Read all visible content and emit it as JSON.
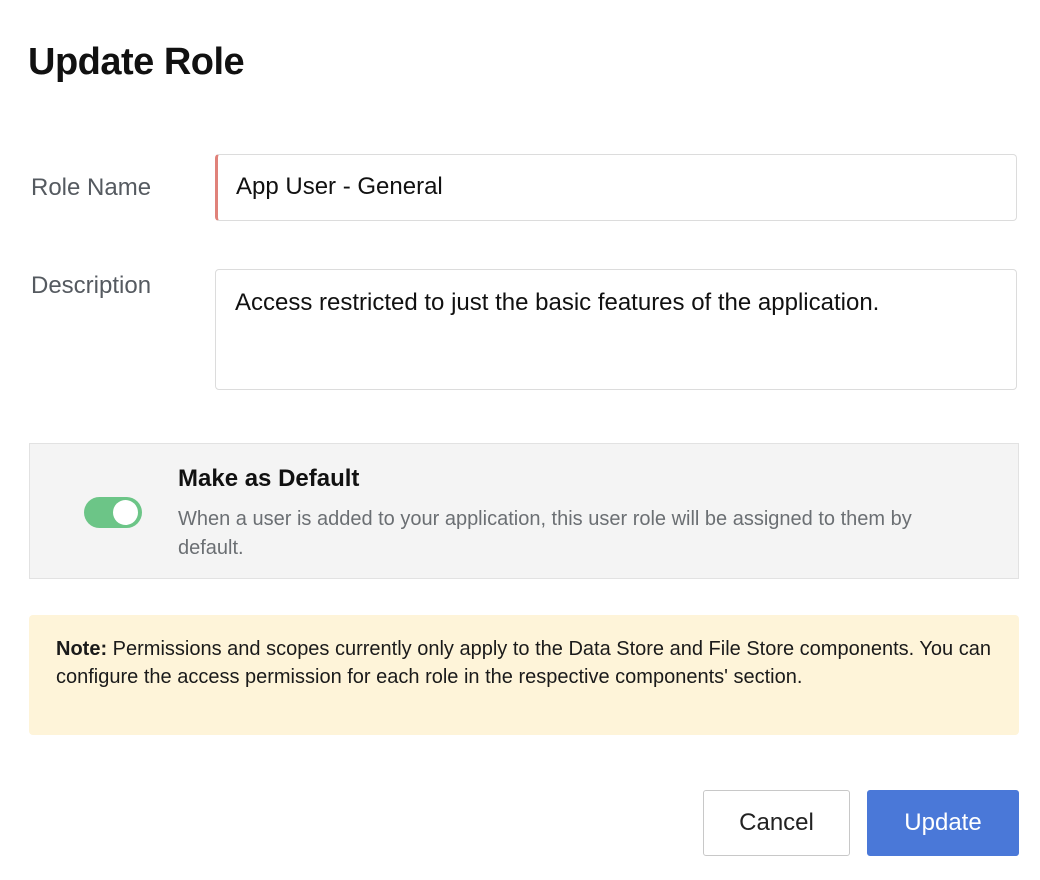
{
  "dialog": {
    "title": "Update Role"
  },
  "form": {
    "role_name_label": "Role Name",
    "role_name_value": "App User - General",
    "description_label": "Description",
    "description_value": "Access restricted to just the basic features of the application."
  },
  "default_toggle": {
    "title": "Make as Default",
    "description": "When a user is added to your application, this user role will be assigned to them by default.",
    "enabled": true,
    "color": "#6cc587"
  },
  "note": {
    "prefix": "Note:",
    "text": " Permissions and scopes currently only apply to the Data Store and File Store components. You can configure the access permission for each role in the respective components' section."
  },
  "actions": {
    "cancel_label": "Cancel",
    "update_label": "Update",
    "primary_color": "#4a78d8"
  }
}
